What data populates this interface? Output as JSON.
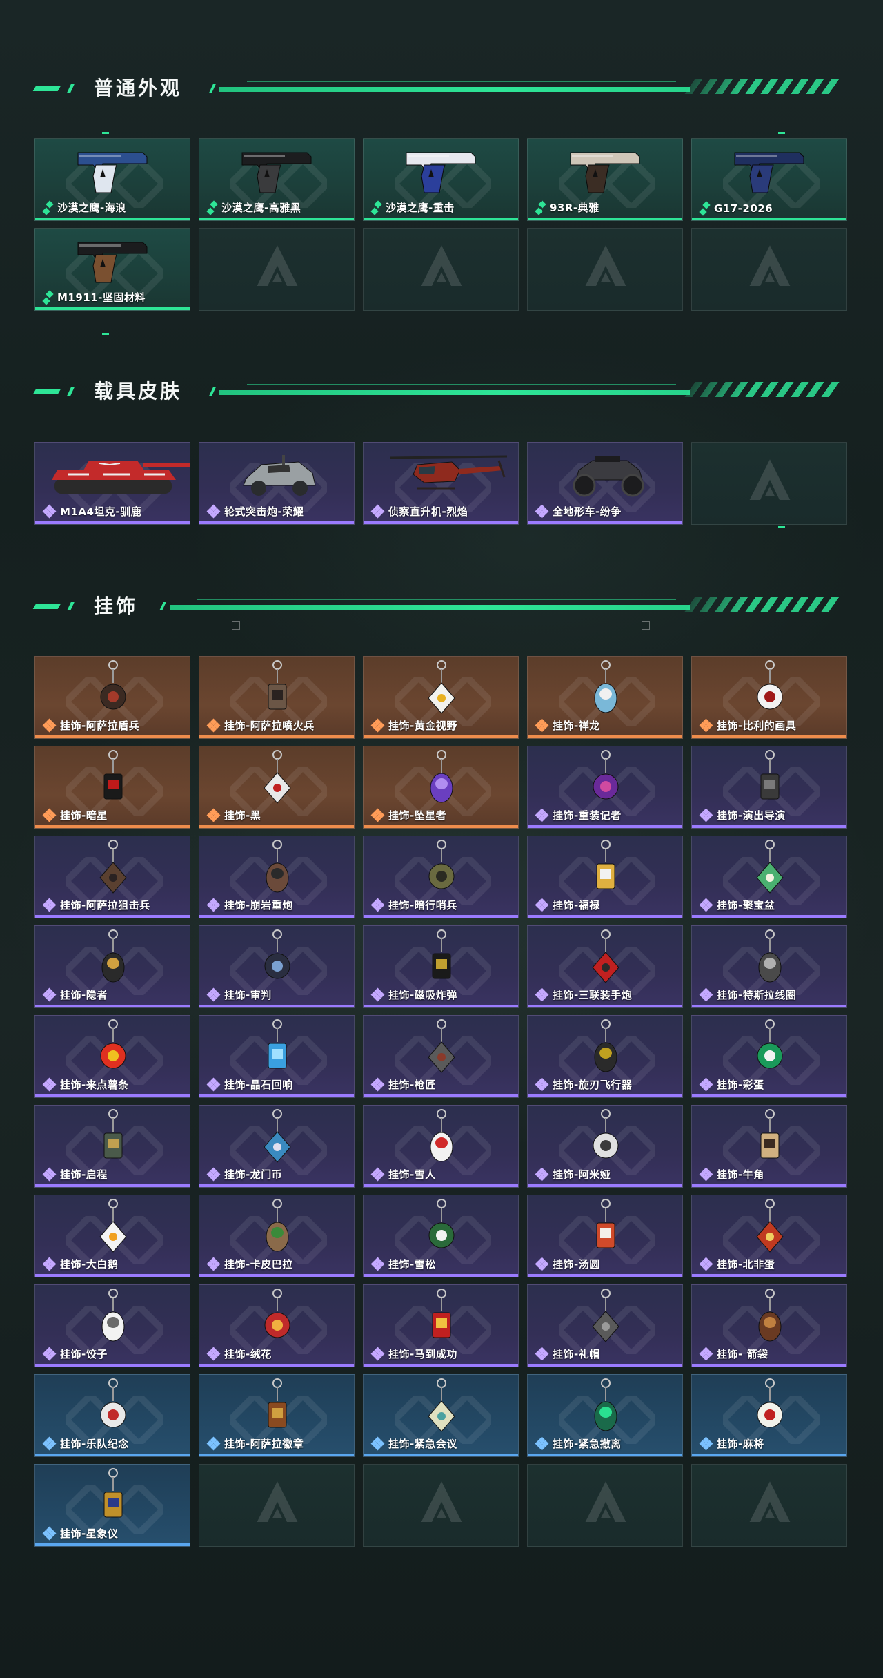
{
  "sections": [
    {
      "title": "普通外观",
      "items": [
        {
          "name": "沙漠之鹰-海浪",
          "rarity": "green",
          "icon": "pistol-deagle-wave-icon",
          "art": "pistol",
          "c1": "#2c4f8f",
          "c2": "#dfe6ef"
        },
        {
          "name": "沙漠之鹰-高雅黑",
          "rarity": "green",
          "icon": "pistol-deagle-black-icon",
          "art": "pistol",
          "c1": "#1c1d1f",
          "c2": "#3a3b3d"
        },
        {
          "name": "沙漠之鹰-重击",
          "rarity": "green",
          "icon": "pistol-deagle-strike-icon",
          "art": "pistol",
          "c1": "#e6e8ef",
          "c2": "#2b3f9b"
        },
        {
          "name": "93R-典雅",
          "rarity": "green",
          "icon": "pistol-93r-icon",
          "art": "pistol",
          "c1": "#cfc6b8",
          "c2": "#3b2d24"
        },
        {
          "name": "G17-2026",
          "rarity": "green",
          "icon": "pistol-g17-icon",
          "art": "pistol",
          "c1": "#1f2f5f",
          "c2": "#2a3b7a"
        },
        {
          "name": "M1911-坚固材料",
          "rarity": "green",
          "icon": "pistol-m1911-icon",
          "art": "pistol",
          "c1": "#1b1c1e",
          "c2": "#7a5030"
        },
        {
          "empty": true
        },
        {
          "empty": true
        },
        {
          "empty": true
        },
        {
          "empty": true
        }
      ]
    },
    {
      "title": "载具皮肤",
      "items": [
        {
          "name": "M1A4坦克-驯鹿",
          "rarity": "purple",
          "icon": "tank-icon",
          "art": "tank",
          "c1": "#c32a2a",
          "c2": "#eeeeee"
        },
        {
          "name": "轮式突击炮-荣耀",
          "rarity": "purple",
          "icon": "armored-car-icon",
          "art": "car",
          "c1": "#9aa0a3",
          "c2": "#2a2c2e"
        },
        {
          "name": "侦察直升机-烈焰",
          "rarity": "purple",
          "icon": "helicopter-icon",
          "art": "heli",
          "c1": "#8f2a1e",
          "c2": "#2a2220"
        },
        {
          "name": "全地形车-纷争",
          "rarity": "purple",
          "icon": "atv-icon",
          "art": "atv",
          "c1": "#1c1c1e",
          "c2": "#3b3b40"
        },
        {
          "empty": true
        }
      ]
    },
    {
      "title": "挂饰",
      "items": [
        {
          "name": "挂饰-阿萨拉盾兵",
          "rarity": "orange",
          "icon": "charm-shield-soldier-icon",
          "art": "charm",
          "c1": "#3b2a22",
          "c2": "#a33a2a"
        },
        {
          "name": "挂饰-阿萨拉喷火兵",
          "rarity": "orange",
          "icon": "charm-flamethrower-icon",
          "art": "charm",
          "c1": "#6b5646",
          "c2": "#2a2220"
        },
        {
          "name": "挂饰-黄金视野",
          "rarity": "orange",
          "icon": "charm-golden-vision-icon",
          "art": "charm",
          "c1": "#f2f2ee",
          "c2": "#e8b020"
        },
        {
          "name": "挂饰-祥龙",
          "rarity": "orange",
          "icon": "charm-dragon-icon",
          "art": "charm",
          "c1": "#7ab8d8",
          "c2": "#f0f0f0"
        },
        {
          "name": "挂饰-比利的画具",
          "rarity": "orange",
          "icon": "charm-billy-mask-icon",
          "art": "charm",
          "c1": "#f2f2f2",
          "c2": "#a01818"
        },
        {
          "name": "挂饰-暗星",
          "rarity": "orange",
          "icon": "charm-dark-star-icon",
          "art": "charm",
          "c1": "#1a1a1a",
          "c2": "#c01a1a"
        },
        {
          "name": "挂饰-黑",
          "rarity": "orange",
          "icon": "charm-black-card-icon",
          "art": "charm",
          "c1": "#e8e8e8",
          "c2": "#c02020"
        },
        {
          "name": "挂饰-坠星者",
          "rarity": "orange",
          "icon": "charm-star-fall-icon",
          "art": "charm",
          "c1": "#6a3fc0",
          "c2": "#b08ef0"
        },
        {
          "name": "挂饰-重装记者",
          "rarity": "purple",
          "icon": "charm-reporter-icon",
          "art": "charm",
          "c1": "#6a2a9a",
          "c2": "#d04aa0"
        },
        {
          "name": "挂饰-演出导演",
          "rarity": "purple",
          "icon": "charm-director-icon",
          "art": "charm",
          "c1": "#3a3a3a",
          "c2": "#7a7a7a"
        },
        {
          "name": "挂饰-阿萨拉狙击兵",
          "rarity": "purple",
          "icon": "charm-sniper-icon",
          "art": "charm",
          "c1": "#5a4030",
          "c2": "#2a2222"
        },
        {
          "name": "挂饰-崩岩重炮",
          "rarity": "purple",
          "icon": "charm-heavy-gunner-icon",
          "art": "charm",
          "c1": "#6b4a3a",
          "c2": "#2a2a2a"
        },
        {
          "name": "挂饰-暗行哨兵",
          "rarity": "purple",
          "icon": "charm-sentinel-icon",
          "art": "charm",
          "c1": "#6a6a40",
          "c2": "#2a2a22"
        },
        {
          "name": "挂饰-福禄",
          "rarity": "purple",
          "icon": "charm-fortune-icon",
          "art": "charm",
          "c1": "#e0b040",
          "c2": "#f2f2f2"
        },
        {
          "name": "挂饰-聚宝盆",
          "rarity": "purple",
          "icon": "charm-treasure-bowl-icon",
          "art": "charm",
          "c1": "#4ab070",
          "c2": "#f2f2e0"
        },
        {
          "name": "挂饰-隐者",
          "rarity": "purple",
          "icon": "charm-hermit-card-icon",
          "art": "charm",
          "c1": "#2a2a2a",
          "c2": "#d0a040"
        },
        {
          "name": "挂饰-审判",
          "rarity": "purple",
          "icon": "charm-judgement-card-icon",
          "art": "charm",
          "c1": "#2a2e40",
          "c2": "#7aa0d0"
        },
        {
          "name": "挂饰-磁吸炸弹",
          "rarity": "purple",
          "icon": "charm-magnet-bomb-icon",
          "art": "charm",
          "c1": "#1a1a1a",
          "c2": "#c0a030"
        },
        {
          "name": "挂饰-三联装手炮",
          "rarity": "purple",
          "icon": "charm-triple-cannon-icon",
          "art": "charm",
          "c1": "#c02020",
          "c2": "#2a2a2a"
        },
        {
          "name": "挂饰-特斯拉线圈",
          "rarity": "purple",
          "icon": "charm-tesla-coil-icon",
          "art": "charm",
          "c1": "#4a4a4a",
          "c2": "#b0b0b0"
        },
        {
          "name": "挂饰-来点薯条",
          "rarity": "purple",
          "icon": "charm-fries-icon",
          "art": "charm",
          "c1": "#e03020",
          "c2": "#f0c020"
        },
        {
          "name": "挂饰-晶石回响",
          "rarity": "purple",
          "icon": "charm-crystal-icon",
          "art": "charm",
          "c1": "#3aa0e0",
          "c2": "#a0e0ff"
        },
        {
          "name": "挂饰-枪匠",
          "rarity": "purple",
          "icon": "charm-gunsmith-icon",
          "art": "charm",
          "c1": "#5a5a5a",
          "c2": "#8a3a2a"
        },
        {
          "name": "挂饰-旋刃飞行器",
          "rarity": "purple",
          "icon": "charm-blade-drone-icon",
          "art": "charm",
          "c1": "#2a2a2a",
          "c2": "#c0a020"
        },
        {
          "name": "挂饰-彩蛋",
          "rarity": "purple",
          "icon": "charm-easter-egg-icon",
          "art": "charm",
          "c1": "#1a9a5a",
          "c2": "#f2f2f2"
        },
        {
          "name": "挂饰-启程",
          "rarity": "purple",
          "icon": "charm-departure-icon",
          "art": "charm",
          "c1": "#4a5a4a",
          "c2": "#c0a050"
        },
        {
          "name": "挂饰-龙门币",
          "rarity": "purple",
          "icon": "charm-dragon-coin-icon",
          "art": "charm",
          "c1": "#3a8ac0",
          "c2": "#e0e0f0"
        },
        {
          "name": "挂饰-雪人",
          "rarity": "purple",
          "icon": "charm-snowman-icon",
          "art": "charm",
          "c1": "#f2f2f2",
          "c2": "#d02a2a"
        },
        {
          "name": "挂饰-阿米娅",
          "rarity": "purple",
          "icon": "charm-amiya-icon",
          "art": "charm",
          "c1": "#e0e0e0",
          "c2": "#3a3a3a"
        },
        {
          "name": "挂饰-牛角",
          "rarity": "purple",
          "icon": "charm-ox-horn-icon",
          "art": "charm",
          "c1": "#d0b080",
          "c2": "#3a2a20"
        },
        {
          "name": "挂饰-大白鹅",
          "rarity": "purple",
          "icon": "charm-white-goose-icon",
          "art": "charm",
          "c1": "#f4f4f4",
          "c2": "#f0a020"
        },
        {
          "name": "挂饰-卡皮巴拉",
          "rarity": "purple",
          "icon": "charm-capybara-icon",
          "art": "charm",
          "c1": "#8a6a4a",
          "c2": "#3a8a3a"
        },
        {
          "name": "挂饰-雪松",
          "rarity": "purple",
          "icon": "charm-cedar-icon",
          "art": "charm",
          "c1": "#2a6a3a",
          "c2": "#f2f2f2"
        },
        {
          "name": "挂饰-汤圆",
          "rarity": "purple",
          "icon": "charm-tangyuan-icon",
          "art": "charm",
          "c1": "#d04a2a",
          "c2": "#f4f0e8"
        },
        {
          "name": "挂饰-北非蛋",
          "rarity": "purple",
          "icon": "charm-shakshuka-icon",
          "art": "charm",
          "c1": "#c03a20",
          "c2": "#f0d060"
        },
        {
          "name": "挂饰-饺子",
          "rarity": "purple",
          "icon": "charm-dumpling-icon",
          "art": "charm",
          "c1": "#f2f2f2",
          "c2": "#6a6a6a"
        },
        {
          "name": "挂饰-绒花",
          "rarity": "purple",
          "icon": "charm-velvet-flower-icon",
          "art": "charm",
          "c1": "#c02a2a",
          "c2": "#f0b040"
        },
        {
          "name": "挂饰-马到成功",
          "rarity": "purple",
          "icon": "charm-horse-icon",
          "art": "charm",
          "c1": "#c02020",
          "c2": "#f0c040"
        },
        {
          "name": "挂饰-礼帽",
          "rarity": "purple",
          "icon": "charm-top-hat-icon",
          "art": "charm",
          "c1": "#5a5a5a",
          "c2": "#9a9a9a"
        },
        {
          "name": "挂饰- 箭袋",
          "rarity": "purple",
          "icon": "charm-quiver-icon",
          "art": "charm",
          "c1": "#6a3a22",
          "c2": "#c08040"
        },
        {
          "name": "挂饰-乐队纪念",
          "rarity": "blue",
          "icon": "charm-band-badge-icon",
          "art": "charm",
          "c1": "#e8e8e8",
          "c2": "#c02a2a"
        },
        {
          "name": "挂饰-阿萨拉徽章",
          "rarity": "blue",
          "icon": "charm-asala-badge-icon",
          "art": "charm",
          "c1": "#8a4a20",
          "c2": "#d0a040"
        },
        {
          "name": "挂饰-紧急会议",
          "rarity": "blue",
          "icon": "charm-emergency-meeting-icon",
          "art": "charm",
          "c1": "#e0e0c0",
          "c2": "#4aa0a0"
        },
        {
          "name": "挂饰-紧急撤离",
          "rarity": "blue",
          "icon": "charm-evacuation-icon",
          "art": "charm",
          "c1": "#1a6a4a",
          "c2": "#2ae090"
        },
        {
          "name": "挂饰-麻将",
          "rarity": "blue",
          "icon": "charm-mahjong-icon",
          "art": "charm",
          "c1": "#f2f2ea",
          "c2": "#c02020"
        },
        {
          "name": "挂饰-星象仪",
          "rarity": "blue",
          "icon": "charm-astrolabe-icon",
          "art": "charm",
          "c1": "#c0902a",
          "c2": "#2a3a8a"
        },
        {
          "empty": true
        },
        {
          "empty": true
        },
        {
          "empty": true
        },
        {
          "empty": true
        }
      ]
    }
  ]
}
